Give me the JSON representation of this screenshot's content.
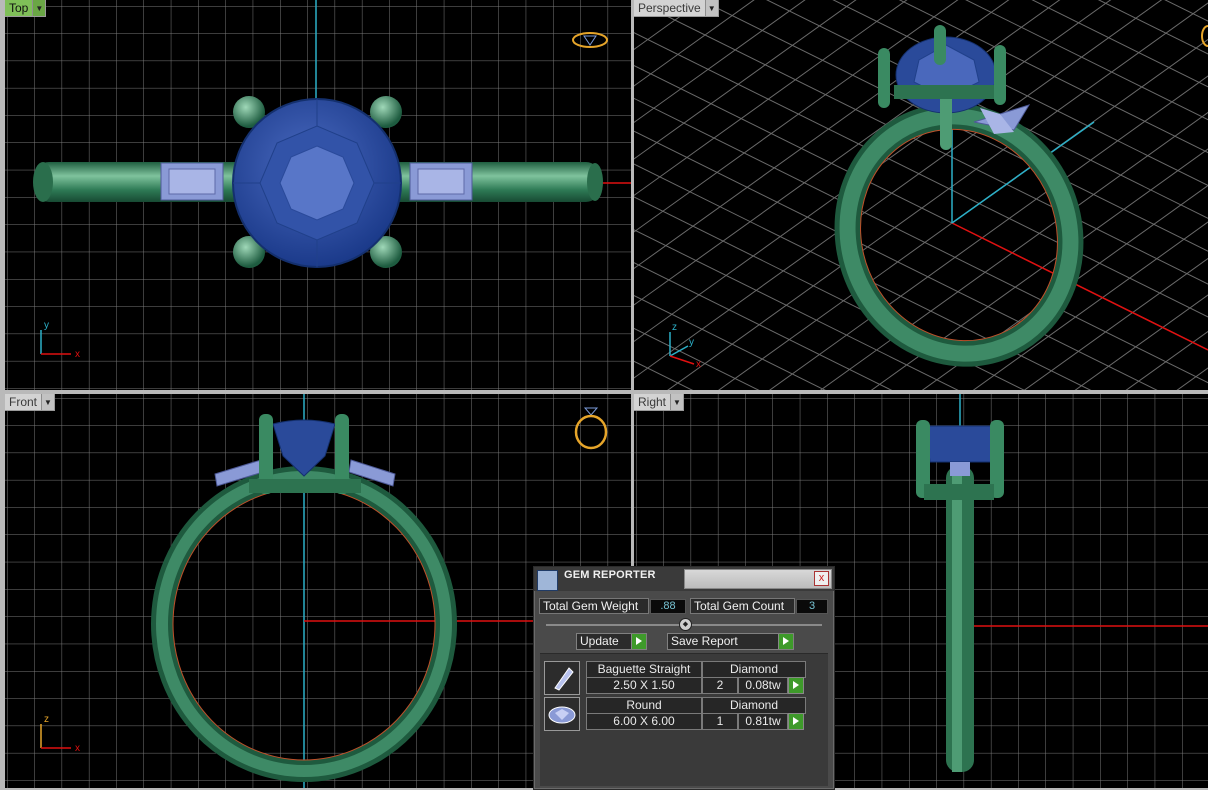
{
  "viewports": {
    "top": {
      "label": "Top",
      "axes": [
        "y",
        "x"
      ]
    },
    "perspective": {
      "label": "Perspective",
      "axes": [
        "z",
        "y",
        "x"
      ]
    },
    "front": {
      "label": "Front",
      "axes": [
        "z",
        "x"
      ]
    },
    "right": {
      "label": "Right"
    }
  },
  "gem_reporter": {
    "title": "GEM REPORTER",
    "close": "x",
    "total_weight_label": "Total Gem Weight",
    "total_weight_value": ".88",
    "total_count_label": "Total Gem Count",
    "total_count_value": "3",
    "update_label": "Update",
    "save_label": "Save Report",
    "gems": [
      {
        "shape": "Baguette Straight",
        "material": "Diamond",
        "size": "2.50 X 1.50",
        "count": "2",
        "weight": "0.08tw"
      },
      {
        "shape": "Round",
        "material": "Diamond",
        "size": "6.00 X 6.00",
        "count": "1",
        "weight": "0.81tw"
      }
    ]
  },
  "colors": {
    "metal": "#2f7a57",
    "metal_highlight": "#6fb18e",
    "gem": "#2a4a9a",
    "baguette": "#8a9ad6",
    "grid": "#7a7a7a",
    "axis_x": "#e01010",
    "axis_y": "#2cb0c8"
  }
}
